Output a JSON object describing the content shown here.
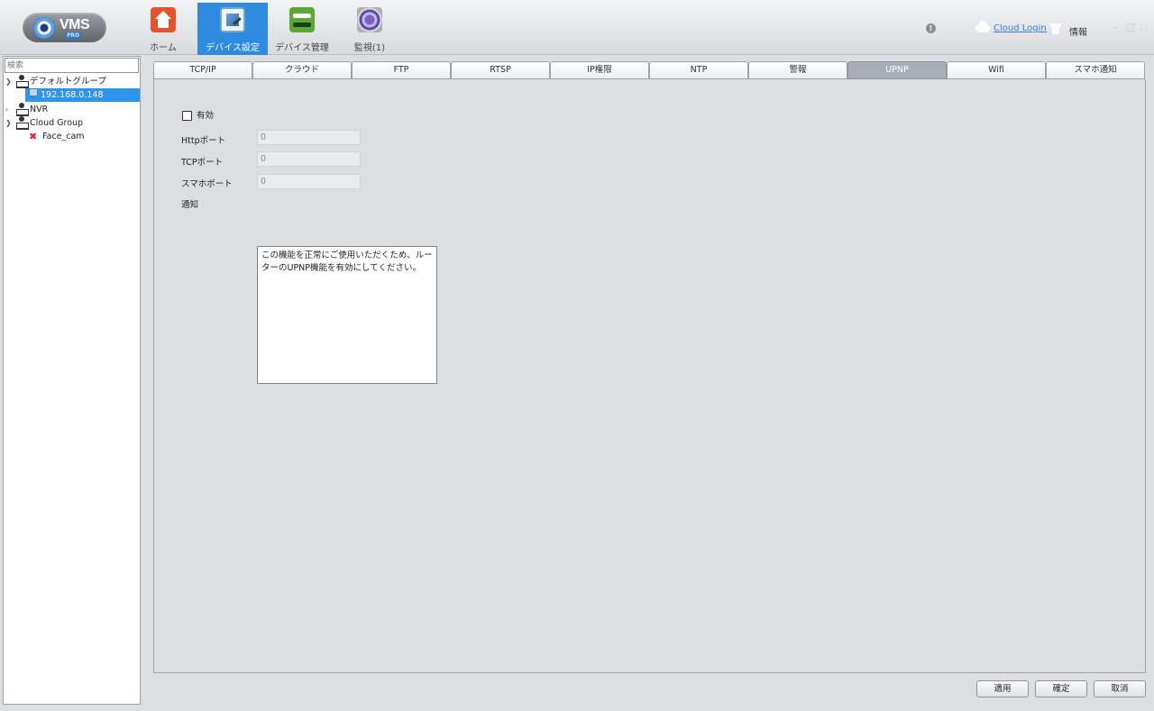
{
  "app": {
    "logo_text": "VMS",
    "logo_badge": "PRO"
  },
  "nav": [
    {
      "label": "ホーム",
      "icon": "home-icon",
      "active": false
    },
    {
      "label": "デバイス設定",
      "icon": "device-settings-icon",
      "active": true
    },
    {
      "label": "デバイス管理",
      "icon": "device-management-icon",
      "active": false
    },
    {
      "label": "監視(1)",
      "icon": "monitor-icon",
      "active": false
    }
  ],
  "header": {
    "status_icon_text": "!",
    "cloud_login": "Cloud Login",
    "info_label": "情報",
    "minimize": "–",
    "maximize": "□",
    "close": "✕"
  },
  "sidebar": {
    "search_placeholder": "検索",
    "tree": [
      {
        "label": "デフォルトグループ",
        "expanded": true,
        "type": "group"
      },
      {
        "label": "192.168.0.148",
        "type": "camera",
        "selected": true
      },
      {
        "label": "NVR",
        "expanded": false,
        "type": "group"
      },
      {
        "label": "Cloud Group",
        "expanded": true,
        "type": "group"
      },
      {
        "label": "Face_cam",
        "type": "camera-offline"
      }
    ]
  },
  "tabs": [
    "TCP/IP",
    "クラウド",
    "FTP",
    "RTSP",
    "IP権限",
    "NTP",
    "警報",
    "UPNP",
    "Wifi",
    "スマホ通知"
  ],
  "active_tab": "UPNP",
  "form": {
    "enable_label": "有効",
    "enabled": false,
    "http_port_label": "Httpポート",
    "http_port_value": "0",
    "tcp_port_label": "TCPポート",
    "tcp_port_value": "0",
    "mobile_port_label": "スマホポート",
    "mobile_port_value": "0",
    "notice_label": "通知",
    "notice_text": "この機能を正常にご使用いただくため、ルーターのUPNP機能を有効にしてください。"
  },
  "buttons": {
    "apply": "適用",
    "ok": "確定",
    "cancel": "取消"
  }
}
